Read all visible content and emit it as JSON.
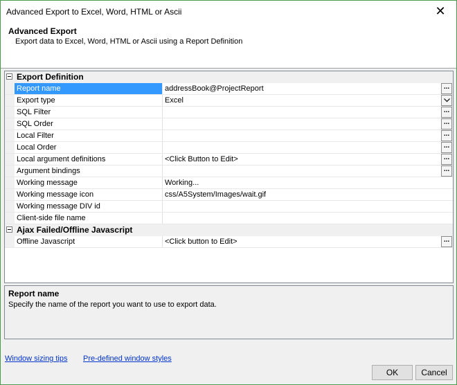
{
  "window": {
    "title": "Advanced Export to Excel, Word, HTML or Ascii",
    "close_glyph": "✕"
  },
  "header": {
    "title": "Advanced Export",
    "subtitle": "Export data to Excel, Word, HTML or Ascii using a Report Definition"
  },
  "grid": {
    "categories": [
      {
        "label": "Export Definition",
        "rows": [
          {
            "name": "Report name",
            "value": "addressBook@ProjectReport",
            "button": "dots"
          },
          {
            "name": "Export type",
            "value": "Excel",
            "button": "dropdown"
          },
          {
            "name": "SQL Filter",
            "value": "",
            "button": "dots"
          },
          {
            "name": "SQL Order",
            "value": "",
            "button": "dots"
          },
          {
            "name": "Local Filter",
            "value": "",
            "button": "dots"
          },
          {
            "name": "Local Order",
            "value": "",
            "button": "dots"
          },
          {
            "name": "Local argument definitions",
            "value": "<Click Button to Edit>",
            "button": "dots"
          },
          {
            "name": "Argument bindings",
            "value": "",
            "button": "dots"
          },
          {
            "name": "Working message",
            "value": "Working...",
            "button": ""
          },
          {
            "name": "Working message icon",
            "value": "css/A5System/Images/wait.gif",
            "button": ""
          },
          {
            "name": "Working message DIV id",
            "value": "",
            "button": ""
          },
          {
            "name": "Client-side file name",
            "value": "",
            "button": ""
          }
        ]
      },
      {
        "label": "Ajax Failed/Offline Javascript",
        "rows": [
          {
            "name": "Offline Javascript",
            "value": "<Click button to Edit>",
            "button": "dots"
          }
        ]
      }
    ],
    "dots_label": "..."
  },
  "description": {
    "title": "Report name",
    "text": "Specify the name of the report you want to use to export data."
  },
  "links": {
    "sizing": "Window sizing tips",
    "styles": "Pre-defined window styles"
  },
  "buttons": {
    "ok": "OK",
    "cancel": "Cancel"
  }
}
